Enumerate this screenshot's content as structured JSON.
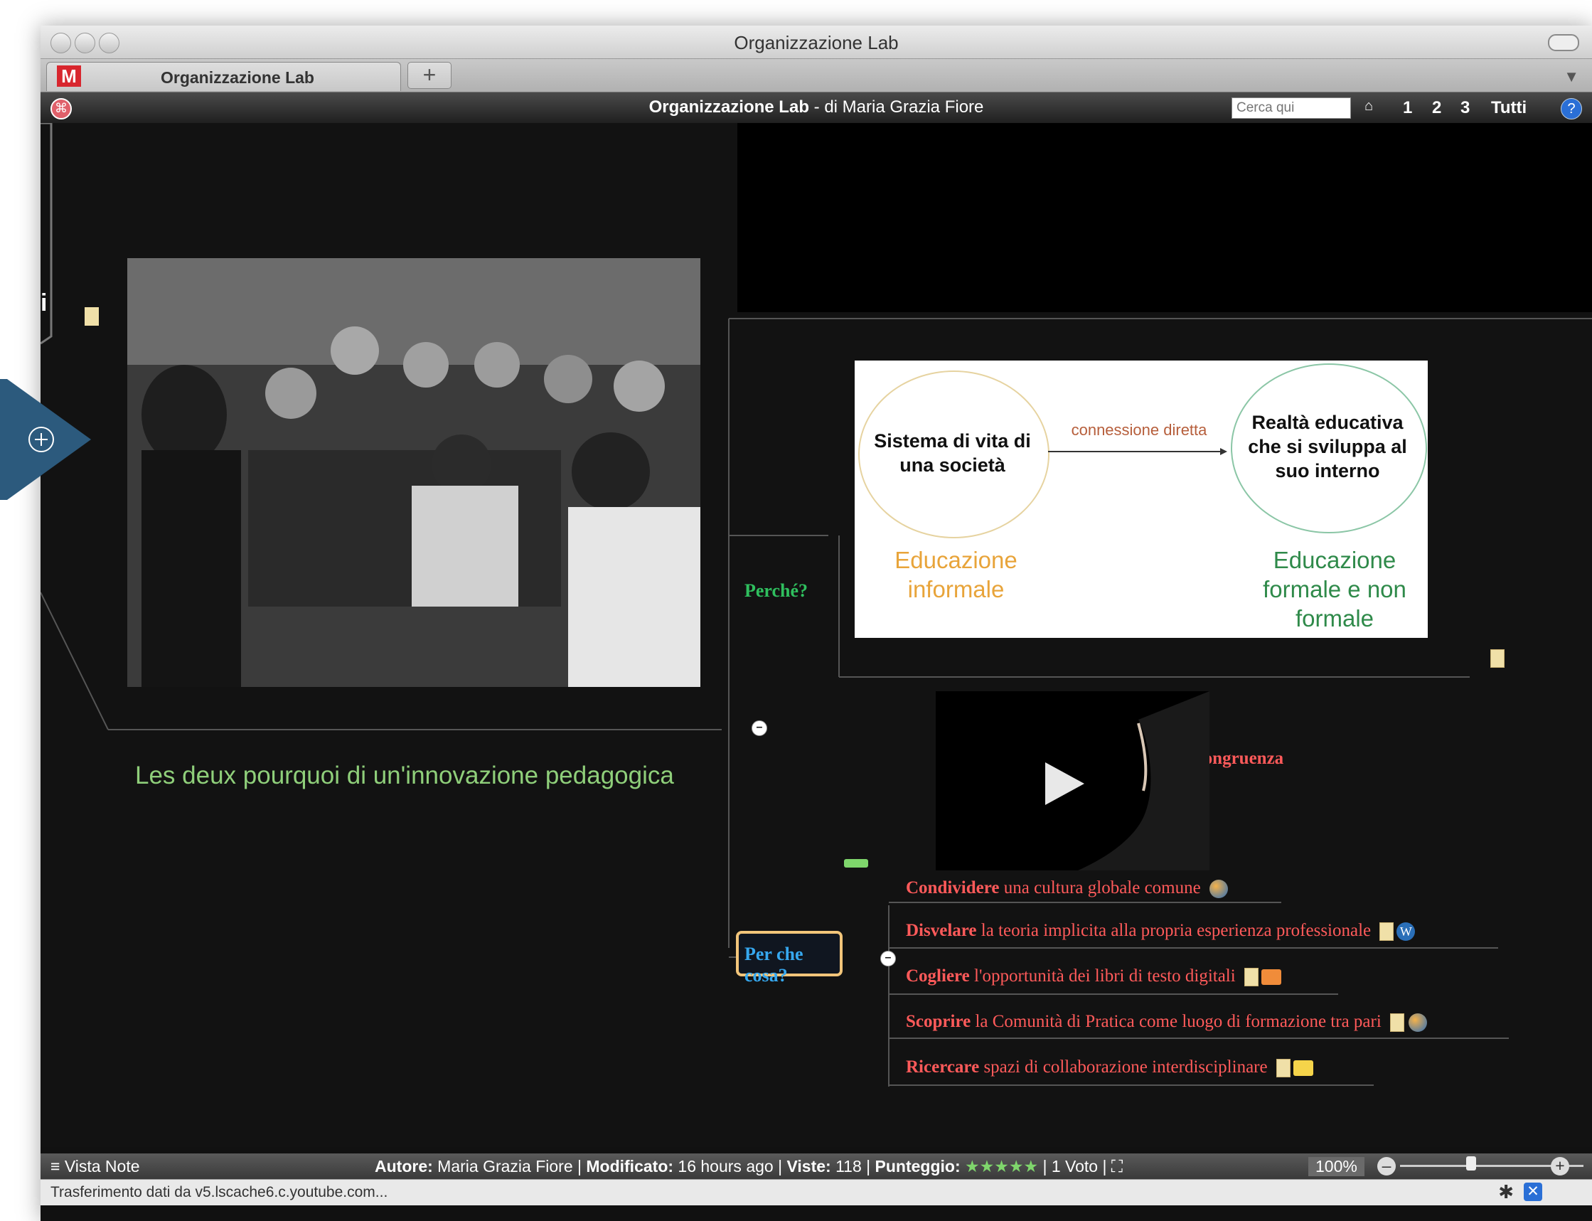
{
  "window": {
    "title": "Organizzazione Lab"
  },
  "tab": {
    "label": "Organizzazione Lab",
    "logo": "M",
    "new_tab": "+"
  },
  "header": {
    "title_bold": "Organizzazione Lab",
    "title_rest": " - di Maria Grazia Fiore",
    "search_placeholder": "Cerca qui",
    "levels": [
      "1",
      "2",
      "3",
      "Tutti"
    ],
    "help": "?"
  },
  "map": {
    "left_fragment": "i",
    "main_label": "Les deux pourquoi di un'innovazione pedagogica",
    "perche": "Perché?",
    "diagram": {
      "left_circle": "Sistema di vita di una società",
      "right_circle": "Realtà educativa che si sviluppa al suo interno",
      "arrow_label": "connessione diretta",
      "left_caption": "Educazione informale",
      "right_caption": "Educazione formale e non formale"
    },
    "ricerca": "Ricerca di un nuovo rapporto di congruenza",
    "per_che_cosa": "Per che cosa?",
    "items": [
      {
        "bold": "Condividere",
        "rest": " una cultura globale comune"
      },
      {
        "bold": "Disvelare",
        "rest": " la teoria implicita alla propria esperienza professionale"
      },
      {
        "bold": "Cogliere",
        "rest": " l'opportunità dei libri di testo digitali"
      },
      {
        "bold": "Scoprire",
        "rest": " la Comunità di Pratica come luogo di formazione tra pari"
      },
      {
        "bold": "Ricercare",
        "rest": " spazi di collaborazione interdisciplinare"
      }
    ]
  },
  "statusbar": {
    "vista_note": "Vista Note",
    "autore_label": "Autore:",
    "autore": "Maria Grazia Fiore",
    "modificato_label": "Modificato:",
    "modificato": "16 hours ago",
    "viste_label": "Viste:",
    "viste": "118",
    "punteggio_label": "Punteggio:",
    "voto": "1 Voto",
    "zoom": "100%",
    "rating_fraction": 0.9
  },
  "footer": {
    "message": "Trasferimento dati da v5.lscache6.c.youtube.com..."
  },
  "colors": {
    "accent": "#36a8ef",
    "red": "#ff5a5a",
    "green": "#2fbf5e",
    "bg": "#121212"
  }
}
